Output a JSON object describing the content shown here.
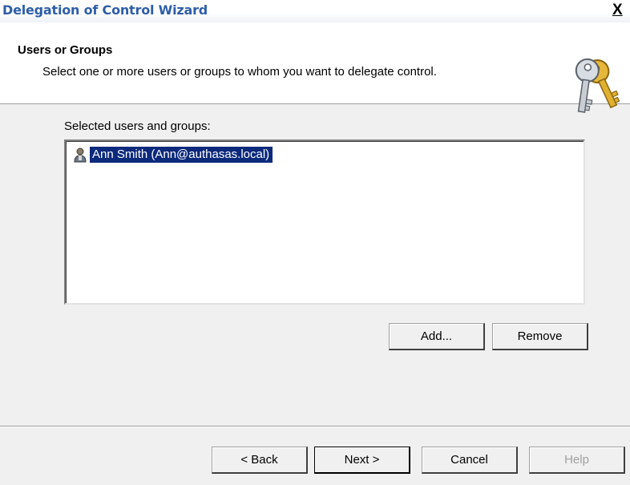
{
  "window": {
    "title": "Delegation of Control Wizard",
    "close_label": "X"
  },
  "header": {
    "title": "Users or Groups",
    "subtitle": "Select one or more users or groups to whom you want to delegate control.",
    "icon": "keys-icon"
  },
  "main": {
    "list_label": "Selected users and groups:",
    "list_items": [
      {
        "label": "Ann Smith (Ann@authasas.local)",
        "icon": "user-icon",
        "selected": true
      }
    ],
    "add_label": "Add...",
    "remove_label": "Remove"
  },
  "footer": {
    "back_label": "< Back",
    "next_label": "Next >",
    "cancel_label": "Cancel",
    "help_label": "Help"
  },
  "colors": {
    "title_text": "#2e5ea8",
    "selection": "#0c2a7c",
    "window_bg": "#f0f0f0"
  }
}
